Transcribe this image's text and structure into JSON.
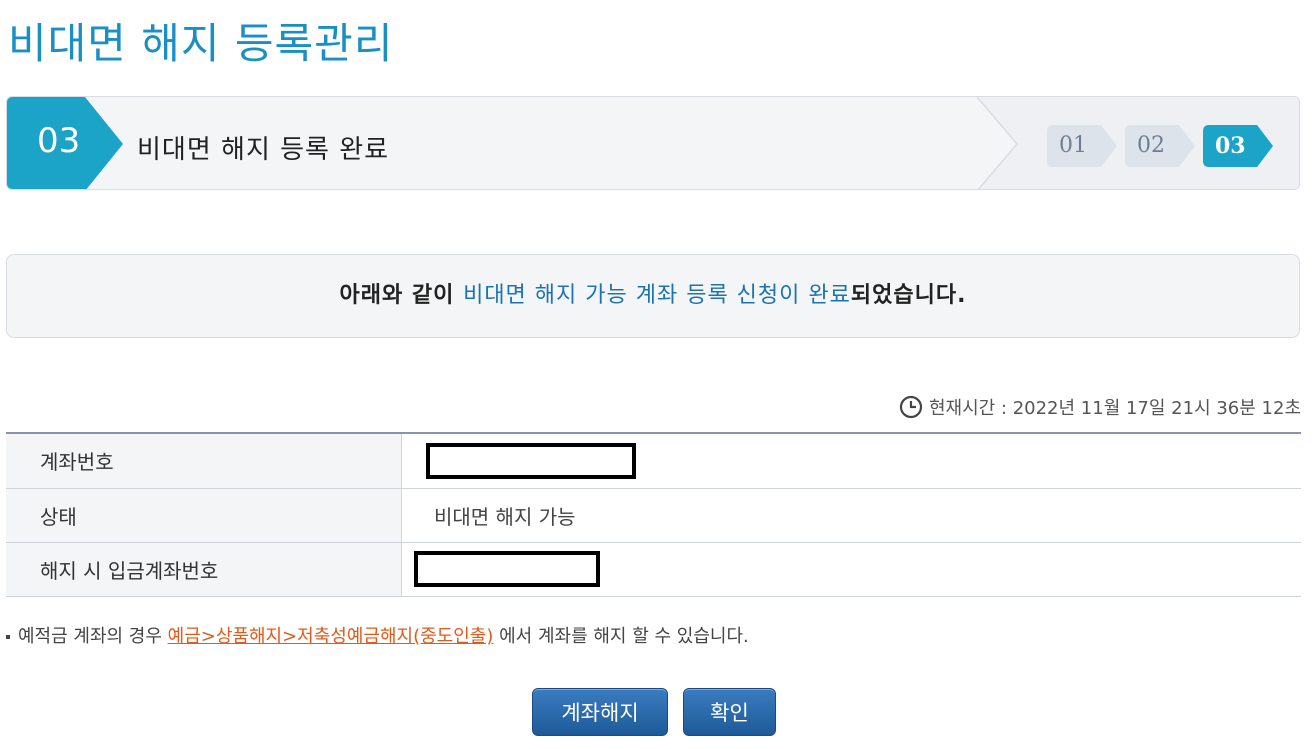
{
  "page": {
    "title": "비대면 해지 등록관리"
  },
  "stepbar": {
    "current_number": "03",
    "current_title": "비대면 해지 등록 완료",
    "steps": [
      {
        "label": "01",
        "state": "inactive"
      },
      {
        "label": "02",
        "state": "inactive"
      },
      {
        "label": "03",
        "state": "active"
      }
    ]
  },
  "notice": {
    "prefix": "아래와 같이 ",
    "highlight": "비대면 해지 가능 계좌 등록 신청이 완료",
    "suffix": "되었습니다."
  },
  "time": {
    "text": "현재시간 : 2022년 11월 17일 21시 36분 12초"
  },
  "table": {
    "rows": [
      {
        "label": "계좌번호",
        "value": ""
      },
      {
        "label": "상태",
        "value": "비대면 해지 가능"
      },
      {
        "label": "해지 시 입금계좌번호",
        "value": ""
      }
    ]
  },
  "note": {
    "prefix": "예적금 계좌의 경우 ",
    "link": "예금>상품해지>저축성예금해지(중도인출)",
    "suffix": " 에서 계좌를 해지 할 수 있습니다."
  },
  "buttons": {
    "terminate": "계좌해지",
    "confirm": "확인"
  },
  "colors": {
    "accent": "#1a8fc4",
    "step_active": "#1ba3c8",
    "step_inactive": "#dde3ea",
    "link": "#e05a1a",
    "button": "#2a68a8"
  }
}
